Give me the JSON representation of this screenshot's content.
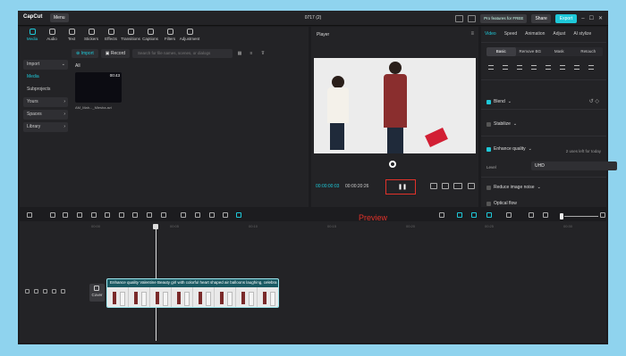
{
  "app": {
    "logo": "CapCut",
    "menu_label": "Menu",
    "project_title": "0717 (2)",
    "pro_label": "Pro features for FREE",
    "share_label": "Share",
    "export_label": "Export",
    "accent_color": "#1ec8d8"
  },
  "tools": [
    {
      "label": "Media",
      "icon": "media-icon"
    },
    {
      "label": "Audio",
      "icon": "audio-icon"
    },
    {
      "label": "Text",
      "icon": "text-icon"
    },
    {
      "label": "Stickers",
      "icon": "stickers-icon"
    },
    {
      "label": "Effects",
      "icon": "effects-icon"
    },
    {
      "label": "Transitions",
      "icon": "transitions-icon"
    },
    {
      "label": "Captions",
      "icon": "captions-icon"
    },
    {
      "label": "Filters",
      "icon": "filters-icon"
    },
    {
      "label": "Adjustment",
      "icon": "adjustment-icon"
    }
  ],
  "media_nav": {
    "import": "Import",
    "media": "Media",
    "subprojects": "Subprojects",
    "yours": "Yours",
    "spaces": "Spaces",
    "library": "Library"
  },
  "media": {
    "import_button": "Import",
    "record_button": "Record",
    "search_placeholder": "Search for file names, scenes, or dialogs",
    "filter_all": "All",
    "clip_duration": "00:43",
    "clip_name": "AM_Mah..._Miesha.avi"
  },
  "player": {
    "label": "Player",
    "time_current": "00:00:00:03",
    "time_total": "00:00:20:26"
  },
  "properties": {
    "tabs": [
      "Video",
      "Speed",
      "Animation",
      "Adjust",
      "AI stylize"
    ],
    "subtabs": [
      "Basic",
      "Remove BG",
      "Mask",
      "Retouch"
    ],
    "blend": "Blend",
    "stabilize": "Stabilize",
    "enhance_quality": "Enhance quality",
    "uses_left": "2 uses left for today",
    "level_label": "Level",
    "level_value": "UHD",
    "reduce_noise": "Reduce image noise",
    "optical_flow": "Optical flow"
  },
  "annotation": {
    "preview_label": "Preview",
    "color": "#e0322a"
  },
  "timeline": {
    "ticks": [
      "00:00",
      "00:05",
      "00:10",
      "00:15",
      "00:20",
      "00:25",
      "00:30",
      "00:35",
      "00:40",
      "00:45"
    ],
    "cover_label": "Cover",
    "clip_title": "Enhance quality   Valentine Beauty girl with colorful heart shaped air balloons laughing, celebra"
  }
}
